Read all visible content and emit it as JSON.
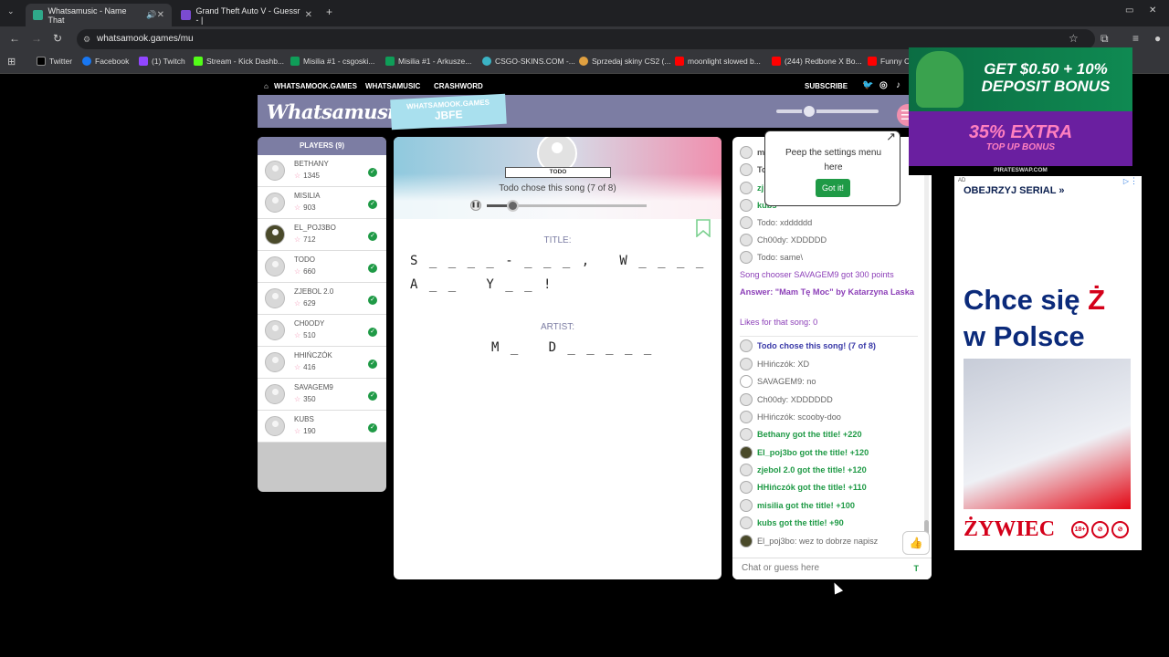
{
  "browser": {
    "tabs": [
      {
        "title": "Whatsamusic - Name That"
      },
      {
        "title": "Grand Theft Auto V - Guessr - |"
      }
    ],
    "url": "whatsamook.games/mu",
    "bookmarks": [
      "Twitter",
      "Facebook",
      "(1) Twitch",
      "Stream - Kick Dashb...",
      "Misilia #1 - csgoski...",
      "Misilia #1 - Arkusze...",
      "CSGO-SKINS.COM -...",
      "Sprzedaj skiny CS2 (...",
      "moonlight slowed b...",
      "(244) Redbone X Bo...",
      "Funny Ch"
    ]
  },
  "site": {
    "nav": [
      "WHATSAMOOK.GAMES",
      "WHATSAMUSIC",
      "CRASHWORD"
    ],
    "subscribe": "SUBSCRIBE",
    "logo": "Whatsamusic",
    "room_label": "WHATSAMOOK.GAMES",
    "room_code": "JBFE"
  },
  "players": {
    "header": "PLAYERS (9)",
    "list": [
      {
        "name": "BETHANY",
        "points": "1345"
      },
      {
        "name": "MISILIA",
        "points": "903"
      },
      {
        "name": "EL_POJ3BO",
        "points": "712"
      },
      {
        "name": "TODO",
        "points": "660"
      },
      {
        "name": "ZJEBOL 2.0",
        "points": "629"
      },
      {
        "name": "CH0ODY",
        "points": "510"
      },
      {
        "name": "HHIŃCZÓK",
        "points": "416"
      },
      {
        "name": "SAVAGEM9",
        "points": "350"
      },
      {
        "name": "KUBS",
        "points": "190"
      }
    ]
  },
  "game": {
    "chooser_name": "TODO",
    "chosen_text": "Todo chose this song (7 of 8)",
    "progress": 0.16,
    "title_label": "TITLE:",
    "title_line1": "S _ _ _ _ - _ _ _ ,   W _ _ _ _",
    "title_line2": "A _ _   Y _ _ !",
    "artist_label": "ARTIST:",
    "artist_line": "M _   D _ _ _ _ _"
  },
  "chat": {
    "messages": [
      "Todo: xdddddd",
      "Ch00dy: XDDDDD",
      "Todo: same\\",
      "Song chooser SAVAGEM9 got 300 points",
      "Answer: \"Mam Tę Moc\" by Katarzyna Laska",
      "Likes for that song: 0",
      "Todo chose this song! (7 of 8)",
      "HHińczók: XD",
      "SAVAGEM9: no",
      "Ch00dy: XDDDDDD",
      "HHińczók: scooby-doo",
      "Bethany got the title! +220",
      "El_poj3bo got the title! +120",
      "zjebol 2.0 got the title! +120",
      "HHińczók got the title! +110",
      "misilia got the title! +100",
      "kubs got the title! +90",
      "El_poj3bo: wez to dobrze napisz"
    ],
    "input_placeholder": "Chat or guess here",
    "input_hint": "T"
  },
  "tooltip": {
    "line1": "Peep the settings menu",
    "line2": "here",
    "button": "Got it!"
  },
  "ads": {
    "top_line1": "GET $0.50 + 10%",
    "top_line2": "DEPOSIT BONUS",
    "top_line3": "35% EXTRA",
    "top_line4": "TOP UP BONUS",
    "top_footer": "PIRATESWAP.COM",
    "side_tag": "AD",
    "side_caption": "OBEJRZYJ SERIAL »",
    "side_big1": "Chce się ",
    "side_big_red": "Ż",
    "side_big2": "w Polsce",
    "side_brand": "ŻYWIEC",
    "side_badge": "18+"
  },
  "colors": {
    "accent": "#7c7da3",
    "pink": "#f08fae",
    "green": "#1f9a46",
    "purple_msg": "#8c3fb8",
    "blue_msg": "#3a3aa8"
  }
}
